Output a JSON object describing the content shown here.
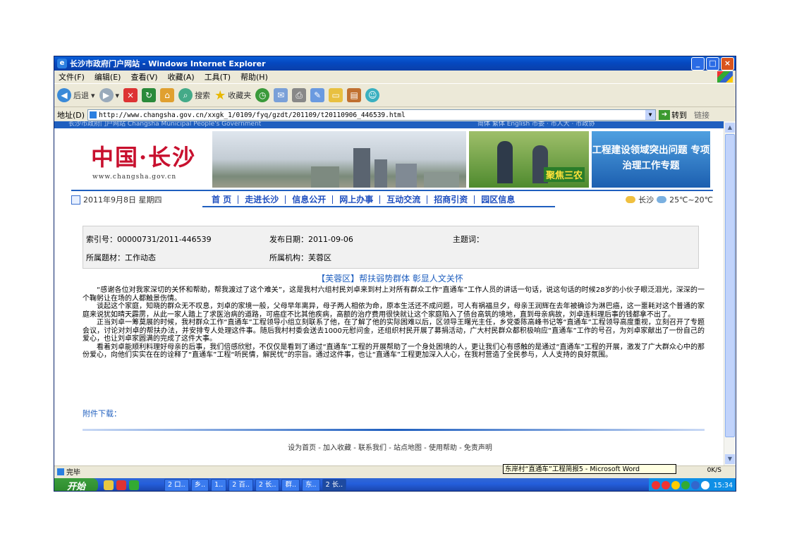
{
  "window": {
    "title": "长沙市政府门户网站 - Windows Internet Explorer"
  },
  "menu": [
    "文件(F)",
    "编辑(E)",
    "查看(V)",
    "收藏(A)",
    "工具(T)",
    "帮助(H)"
  ],
  "toolbar": {
    "back": "后退",
    "search": "搜索",
    "favorites": "收藏夹"
  },
  "address": {
    "label": "地址(D)",
    "url": "http://www.changsha.gov.cn/xxgk_1/0109/fyq/gzdt/201109/t20110906_446539.html",
    "go": "转到",
    "links": "链接"
  },
  "site": {
    "toplinks_left": "长沙市政府门户网站 Changsha Municipal People's Government",
    "toplinks_right": "简体   繁体   English        市委 · 市人大 · 市政协",
    "logo": "中国·长沙",
    "logo_url": "www.changsha.gov.cn",
    "banner_tag": "聚焦三农",
    "banner_project": "工程建设领域突出问题 专项治理工作专题",
    "date": "2011年9月8日 星期四",
    "nav": [
      "首 页",
      "走进长沙",
      "信息公开",
      "网上办事",
      "互动交流",
      "招商引资",
      "园区信息"
    ],
    "weather_city": "长沙",
    "weather_temp": "25℃~20℃"
  },
  "meta": {
    "index": "索引号：00000731/2011-446539",
    "date": "发布日期：2011-09-06",
    "keywords": "主题词：",
    "topic": "所属题材：工作动态",
    "org": "所属机构：芙蓉区"
  },
  "article": {
    "title": "【芙蓉区】帮扶弱势群体 彰显人文关怀",
    "paragraphs": [
      "“感谢各位对我家深切的关怀和帮助，帮我渡过了这个难关”，这是我村六组村民刘卓来到村上对所有群众工作“直通车”工作人员的讲话一句话，说这句话的时候28岁的小伙子眼泛泪光，深深的一个鞠躬让在场的人都触景伤情。",
      "谈起这个家庭，知晓的群众无不叹息，刘卓的家境一般，父母早年离异，母子两人相依为命，原本生活还不成问题，可人有祸福旦夕，母亲王润辉在去年被确诊为淋巴癌，这一噩耗对这个普通的家庭来说犹如晴天霹雳，从此一家人踏上了求医治病的道路，可癌症不比其他疾病，高额的治疗费用很快就让这个家庭陷入了债台高筑的境地，直到母亲病故，刘卓连料理后事的钱都拿不出了。",
      "正当刘卓一筹莫展的时候，我村群众工作“直通车”工程领导小组立刻联系了他，在了解了他的实际困难以后，区领导王曙光主任，乡党委陈高峰书记等“直通车”工程领导高度重视，立刻召开了专题会议，讨论对刘卓的帮扶办法，并安排专人处理这件事。随后我村村委会送去1000元慰问金，还组织村民开展了募捐活动，广大村民群众都积极响应“直通车”工作的号召，为刘卓家献出了一份自己的爱心，也让刘卓家圆满的完成了这件大事。",
      "看着刘卓能顺利料理好母亲的后事，我们倍感欣慰，不仅仅是看到了通过“直通车”工程的开展帮助了一个身处困境的人，更让我们心有感触的是通过“直通车”工程的开展，激发了广大群众心中的那份爱心，向他们实实在在的诠释了“直通车”工程“听民情，解民忧”的宗旨。通过这件事，也让“直通车”工程更加深入人心，在我村营造了全民参与，人人支持的良好氛围。"
    ],
    "attach": "附件下载："
  },
  "footer": "设为首页 - 加入收藏 - 联系我们 - 站点地图 - 使用帮助 - 免责声明",
  "status": {
    "text": "完毕",
    "tooltip": "东岸村“直通车”工程简报5 - Microsoft Word",
    "speed": "0K/S"
  },
  "taskbar": {
    "start": "开始",
    "tasks": [
      "2 口..",
      "乡..",
      "1..",
      "2 百..",
      "2 长..",
      "群..",
      "东..",
      "2 长.."
    ],
    "clock": "15:34"
  }
}
